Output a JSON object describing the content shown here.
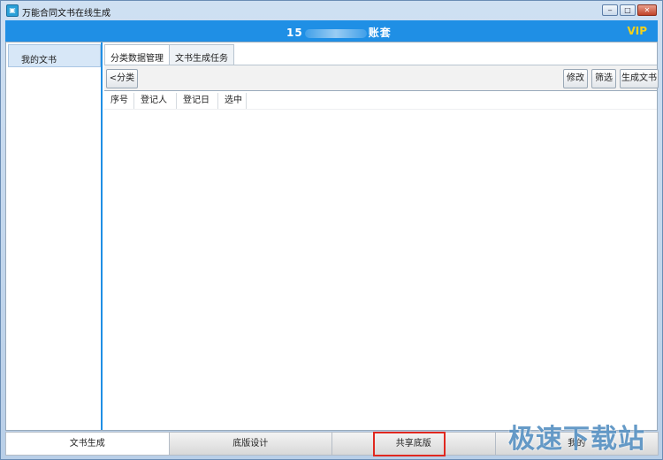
{
  "window": {
    "title": "万能合同文书在线生成",
    "controls": {
      "minimize": "‒",
      "maximize": "□",
      "close": "✕"
    }
  },
  "header": {
    "account_prefix": "15",
    "account_suffix": "账套",
    "vip": "VIP"
  },
  "sidebar": {
    "items": [
      {
        "label": "我的文书"
      }
    ]
  },
  "main": {
    "tabs": [
      {
        "label": "分类数据管理",
        "active": true
      },
      {
        "label": "文书生成任务",
        "active": false
      }
    ],
    "toolbar": {
      "category_label": "<分类",
      "edit_label": "修改",
      "filter_label": "筛选",
      "generate_label": "生成文书"
    },
    "table": {
      "columns": [
        "序号",
        "登记人",
        "登记日",
        "选中"
      ],
      "rows": []
    }
  },
  "bottom_nav": {
    "tabs": [
      {
        "label": "文书生成",
        "active": true
      },
      {
        "label": "底版设计",
        "active": false
      },
      {
        "label": "共享底版",
        "active": false,
        "highlighted": true
      },
      {
        "label": "我的",
        "active": false
      }
    ]
  },
  "watermark": "极速下载站",
  "colors": {
    "header": "#1f8fe5",
    "vip": "#f3d11b",
    "highlight": "#e0281f"
  }
}
